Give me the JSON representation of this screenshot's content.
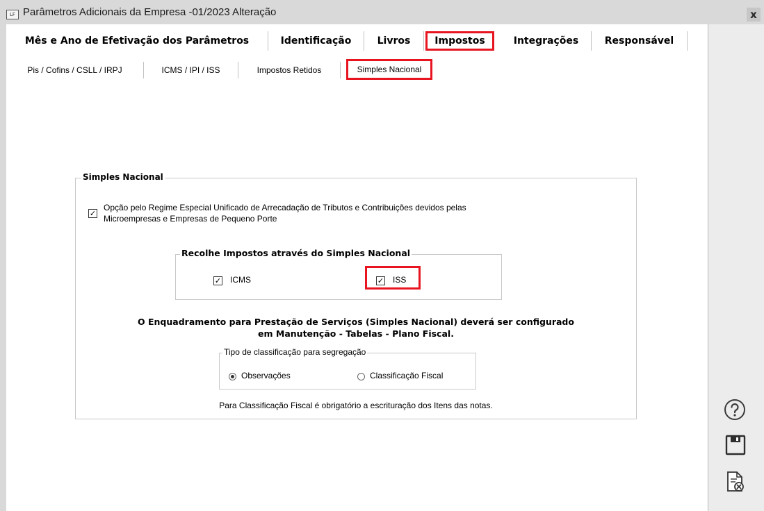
{
  "window": {
    "title": "Parâmetros Adicionais da Empresa -01/2023 Alteração",
    "icon_text": "LF",
    "close": "x"
  },
  "main_tabs": [
    {
      "label": "Mês e Ano de Efetivação dos Parâmetros"
    },
    {
      "label": "Identificação"
    },
    {
      "label": "Livros"
    },
    {
      "label": "Impostos"
    },
    {
      "label": "Integrações"
    },
    {
      "label": "Responsável"
    }
  ],
  "sub_tabs": [
    {
      "label": "Pis / Cofins / CSLL / IRPJ"
    },
    {
      "label": "ICMS / IPI / ISS"
    },
    {
      "label": "Impostos Retidos"
    },
    {
      "label": "Simples Nacional"
    }
  ],
  "simples": {
    "group_title": "Simples Nacional",
    "option_line1": "Opção pelo Regime Especial Unificado de Arrecadação de Tributos e Contribuições devidos pelas",
    "option_line2": "Microempresas e Empresas de Pequeno Porte",
    "option_checked": true,
    "recolhe_title": "Recolhe Impostos através do Simples Nacional",
    "icms_label": "ICMS",
    "icms_checked": true,
    "iss_label": "ISS",
    "iss_checked": true,
    "enquadramento_line1": "O Enquadramento para Prestação de Serviços (Simples Nacional) deverá ser configurado",
    "enquadramento_line2": "em Manutenção - Tabelas - Plano Fiscal.",
    "tipo_title": "Tipo de classificação para segregação",
    "radio_observacoes": "Observações",
    "radio_classificacao": "Classificação Fiscal",
    "radio_selected": "Observações",
    "nota": "Para Classificação Fiscal é obrigatório a escrituração dos Itens das notas."
  },
  "side_icons": [
    "help-icon",
    "save-icon",
    "cancel-document-icon"
  ],
  "highlight_color": "#e8141f"
}
